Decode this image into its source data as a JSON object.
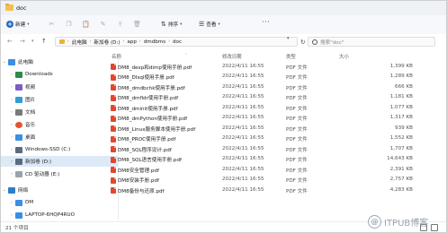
{
  "window": {
    "title": "doc"
  },
  "toolbar": {
    "new_label": "新建",
    "sort_label": "排序",
    "view_label": "查看",
    "more_label": "···"
  },
  "address": {
    "crumbs": [
      "此电脑",
      "新加卷 (D:)",
      "app",
      "dmdbms",
      "doc"
    ],
    "search_placeholder": "搜索\"doc\""
  },
  "sidebar": {
    "items": [
      {
        "label": "此电脑",
        "icon": "computer-icon",
        "expanded": true
      },
      {
        "label": "Downloads",
        "icon": "download-icon"
      },
      {
        "label": "视频",
        "icon": "video-icon"
      },
      {
        "label": "图片",
        "icon": "picture-icon"
      },
      {
        "label": "文档",
        "icon": "document-icon"
      },
      {
        "label": "音乐",
        "icon": "music-icon"
      },
      {
        "label": "桌面",
        "icon": "desktop-icon"
      },
      {
        "label": "Windows-SSD (C:)",
        "icon": "drive-icon"
      },
      {
        "label": "新加卷 (D:)",
        "icon": "drive-icon",
        "selected": true
      },
      {
        "label": "CD 驱动器 (E:)",
        "icon": "cd-drive-icon"
      },
      {
        "label": "网络",
        "icon": "network-icon",
        "expanded": true
      },
      {
        "label": "DM",
        "icon": "monitor-icon"
      },
      {
        "label": "LAPTOP-6HQP4RUO",
        "icon": "monitor-icon"
      }
    ]
  },
  "filelist": {
    "headers": {
      "name": "名称",
      "date": "修改日期",
      "type": "类型",
      "size": "大小"
    },
    "files": [
      {
        "name": "DM8_dexp和dimp使用手册.pdf",
        "date": "2022/4/11 16:55",
        "type": "PDF 文件",
        "size": "1,399 KB"
      },
      {
        "name": "DM8_DIsql使用手册.pdf",
        "date": "2022/4/11 16:55",
        "type": "PDF 文件",
        "size": "1,289 KB"
      },
      {
        "name": "DM8_dmdbchk使用手册.pdf",
        "date": "2022/4/11 16:55",
        "type": "PDF 文件",
        "size": "666 KB"
      },
      {
        "name": "DM8_dmfldr使用手册.pdf",
        "date": "2022/4/11 16:55",
        "type": "PDF 文件",
        "size": "1,181 KB"
      },
      {
        "name": "DM8_dminit使用手册.pdf",
        "date": "2022/4/11 16:55",
        "type": "PDF 文件",
        "size": "1,077 KB"
      },
      {
        "name": "DM8_dmPython使用手册.pdf",
        "date": "2022/4/11 16:55",
        "type": "PDF 文件",
        "size": "1,317 KB"
      },
      {
        "name": "DM8_Linux服务脚本使用手册.pdf",
        "date": "2022/4/11 16:55",
        "type": "PDF 文件",
        "size": "939 KB"
      },
      {
        "name": "DM8_PROC使用手册.pdf",
        "date": "2022/4/11 16:55",
        "type": "PDF 文件",
        "size": "1,552 KB"
      },
      {
        "name": "DM8_SQL程序设计.pdf",
        "date": "2022/4/11 16:55",
        "type": "PDF 文件",
        "size": "1,707 KB"
      },
      {
        "name": "DM8_SQL语言使用手册.pdf",
        "date": "2022/4/11 16:55",
        "type": "PDF 文件",
        "size": "14,643 KB"
      },
      {
        "name": "DM8安全管理.pdf",
        "date": "2022/4/11 16:55",
        "type": "PDF 文件",
        "size": "2,391 KB"
      },
      {
        "name": "DM8安装手册.pdf",
        "date": "2022/4/11 16:55",
        "type": "PDF 文件",
        "size": "2,757 KB"
      },
      {
        "name": "DM8备份与还原.pdf",
        "date": "2022/4/11 16:55",
        "type": "PDF 文件",
        "size": "4,283 KB"
      }
    ]
  },
  "status": {
    "count": "21 个项目"
  },
  "watermark": {
    "text": "ITPUB博客"
  }
}
